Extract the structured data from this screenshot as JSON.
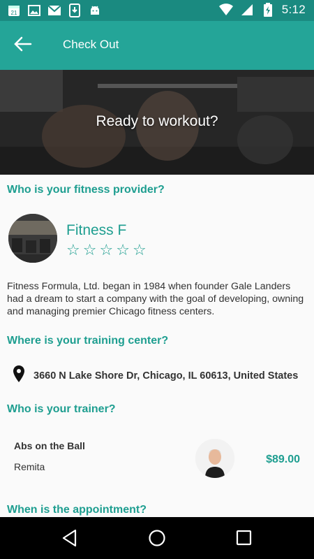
{
  "status_bar": {
    "time": "5:12",
    "icons": [
      "calendar-icon",
      "image-icon",
      "gmail-icon",
      "download-icon",
      "android-icon",
      "wifi-icon",
      "signal-icon",
      "battery-icon"
    ],
    "colors": {
      "background": "#1a8a80"
    }
  },
  "app_bar": {
    "title": "Check Out",
    "back_icon": "arrow-back-icon",
    "colors": {
      "background": "#24a598"
    }
  },
  "hero": {
    "text": "Ready to workout?"
  },
  "provider_section": {
    "title": "Who is your fitness provider?",
    "name": "Fitness F",
    "rating": 0,
    "max_rating": 5,
    "description": "Fitness Formula, Ltd. began in 1984 when founder Gale Landers had a dream to start a company with the goal of developing, owning and managing premier Chicago fitness centers."
  },
  "center_section": {
    "title": "Where is your training center?",
    "address": "3660 N Lake Shore Dr, Chicago, IL 60613, United States"
  },
  "trainer_section": {
    "title": "Who is your trainer?",
    "class_name": "Abs on the Ball",
    "trainer_name": "Remita",
    "price": "$89.00"
  },
  "appointment_section": {
    "title": "When is the appointment?"
  },
  "nav_bar": {
    "buttons": [
      "back-triangle-icon",
      "home-circle-icon",
      "recents-square-icon"
    ]
  },
  "accent_color": "#1e9e90"
}
